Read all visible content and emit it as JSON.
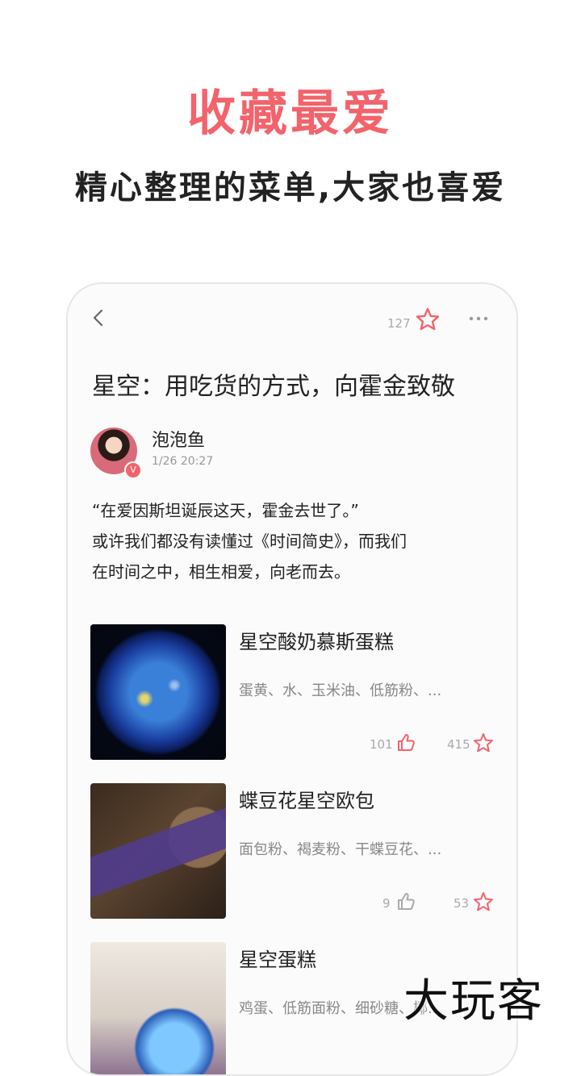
{
  "promo": {
    "headline": "收藏最爱",
    "subline": "精心整理的菜单,大家也喜爱"
  },
  "topbar": {
    "favorite_count": "127",
    "icons": [
      "back-icon",
      "star-icon",
      "more-icon"
    ]
  },
  "article": {
    "title": "星空：用吃货的方式，向霍金致敬",
    "author": "泡泡鱼",
    "verified_badge": "V",
    "date": "1/26 20:27",
    "paragraph": [
      "“在爱因斯坦诞辰这天，霍金去世了。”",
      "或许我们都没有读懂过《时间简史》，而我们",
      "在时间之中，相生相爱，向老而去。"
    ]
  },
  "recipes": [
    {
      "name": "星空酸奶慕斯蛋糕",
      "ingredients": "蛋黄、水、玉米油、低筋粉、...",
      "likes": "101",
      "favorites": "415"
    },
    {
      "name": "蝶豆花星空欧包",
      "ingredients": "面包粉、褐麦粉、干蝶豆花、...",
      "likes": "9",
      "favorites": "53"
    },
    {
      "name": "星空蛋糕",
      "ingredients": "鸡蛋、低筋面粉、细砂糖、椰..."
    }
  ],
  "watermark": "大玩客",
  "colors": {
    "accent": "#f2636b",
    "text": "#222222",
    "muted": "#aaaaaa"
  }
}
